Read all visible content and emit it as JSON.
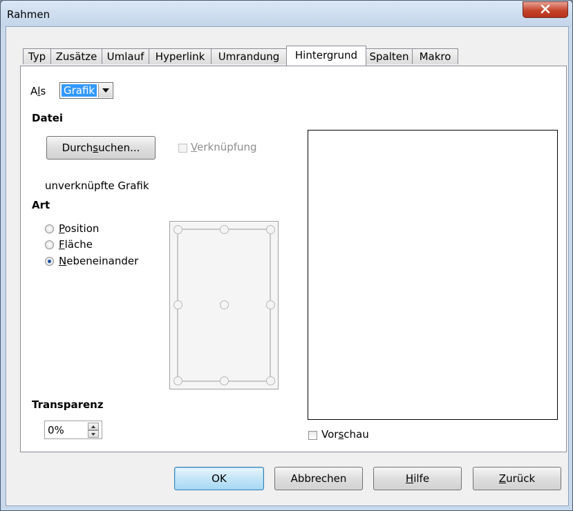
{
  "window": {
    "title": "Rahmen"
  },
  "tabs": [
    {
      "label": "Typ"
    },
    {
      "label": "Zusätze"
    },
    {
      "label": "Umlauf"
    },
    {
      "label": "Hyperlink"
    },
    {
      "label": "Umrandung"
    },
    {
      "label": "Hintergrund",
      "active": true
    },
    {
      "label": "Spalten"
    },
    {
      "label": "Makro"
    }
  ],
  "als": {
    "label_pre": "A",
    "label_ul": "l",
    "label_post": "s",
    "value": "Grafik"
  },
  "datei": {
    "heading": "Datei",
    "browse_pre": "Durch",
    "browse_ul": "s",
    "browse_post": "uchen...",
    "link_ul": "V",
    "link_post": "erknüpfung",
    "link_checked": false,
    "status": "unverknüpfte Grafik"
  },
  "art": {
    "heading": "Art",
    "options": [
      {
        "ul": "P",
        "rest": "osition",
        "checked": false
      },
      {
        "ul": "F",
        "rest": "läche",
        "checked": false
      },
      {
        "ul": "N",
        "rest": "ebeneinander",
        "checked": true
      }
    ]
  },
  "transparency": {
    "heading": "Transparenz",
    "value": "0%"
  },
  "preview": {
    "pre": "Vor",
    "ul": "s",
    "post": "chau",
    "checked": false
  },
  "buttons": {
    "ok": "OK",
    "cancel": "Abbrechen",
    "help_ul": "H",
    "help_rest": "ilfe",
    "reset_ul": "Z",
    "reset_rest": "urück"
  },
  "colors": {
    "selection": "#3399ff",
    "title_bg": "#c9d9ec",
    "close": "#c5452d"
  }
}
